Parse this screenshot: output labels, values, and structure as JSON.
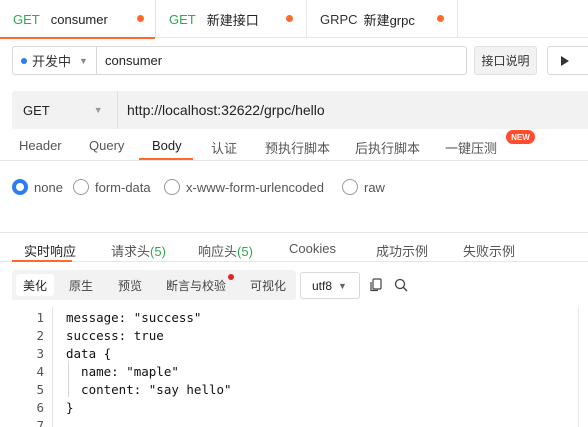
{
  "tabs": [
    {
      "method": "GET",
      "name": "consumer",
      "active": true
    },
    {
      "method": "GET",
      "name": "新建接口",
      "active": false
    },
    {
      "method": "GRPC",
      "name": "新建grpc",
      "active": false
    }
  ],
  "env": {
    "status": "开发中",
    "name": "consumer"
  },
  "toolbar": {
    "doc_label": "接口说明"
  },
  "request": {
    "method": "GET",
    "url": "http://localhost:32622/grpc/hello"
  },
  "req_tabs": [
    "Header",
    "Query",
    "Body",
    "认证",
    "预执行脚本",
    "后执行脚本",
    "一键压测"
  ],
  "new_badge": "NEW",
  "body_types": [
    "none",
    "form-data",
    "x-www-form-urlencoded",
    "raw"
  ],
  "resp_tabs": {
    "realtime": "实时响应",
    "req_headers": "请求头",
    "req_headers_count": "(5)",
    "resp_headers": "响应头",
    "resp_headers_count": "(5)",
    "cookies": "Cookies",
    "success_example": "成功示例",
    "fail_example": "失败示例"
  },
  "view_modes": [
    "美化",
    "原生",
    "预览",
    "断言与校验",
    "可视化"
  ],
  "encoding": "utf8",
  "code": {
    "line_numbers": [
      "1",
      "2",
      "3",
      "4",
      "5",
      "6",
      "7"
    ],
    "lines": [
      "message: \"success\"",
      "success: true",
      "data {",
      "  name: \"maple\"",
      "  content: \"say hello\"",
      "}",
      ""
    ]
  },
  "colors": {
    "accent": "#ff6a2b",
    "method_get": "#2fa84f",
    "radio_selected": "#2d7cf6",
    "badge": "#ff4d2e"
  }
}
